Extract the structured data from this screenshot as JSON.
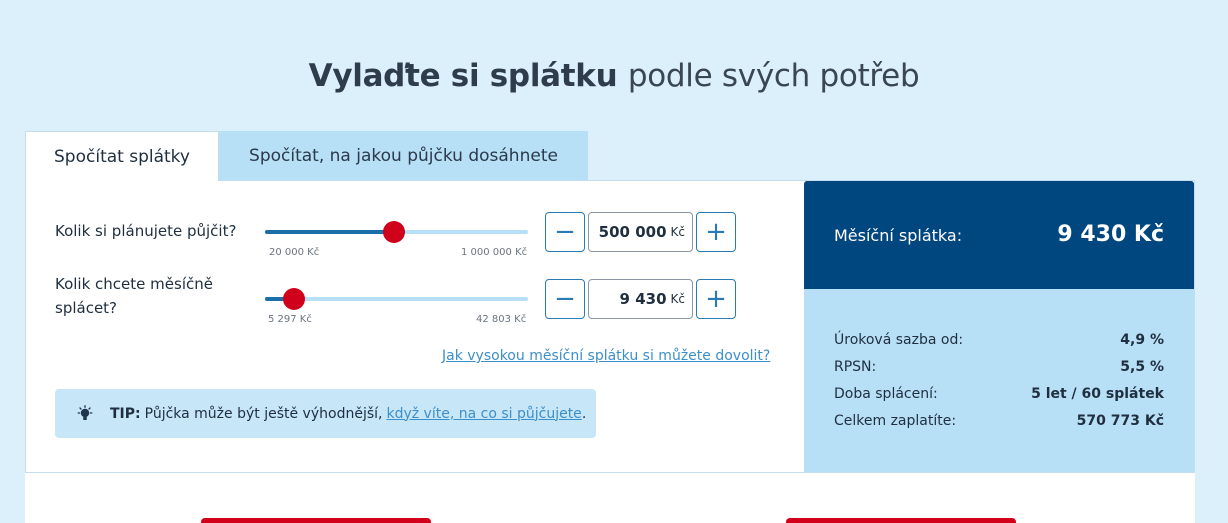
{
  "headline": {
    "bold": "Vylaďte si splátku",
    "light": "podle svých potřeb"
  },
  "tabs": [
    {
      "label": "Spočítat splátky",
      "active": true
    },
    {
      "label": "Spočítat, na jakou půjčku dosáhnete",
      "active": false
    }
  ],
  "loan": {
    "label": "Kolik si plánujete půjčit?",
    "min_label": "20 000 Kč",
    "max_label": "1 000 000 Kč",
    "min": 20000,
    "max": 1000000,
    "slider_position": 0.49,
    "value": "500 000",
    "unit": "Kč",
    "minus": "−",
    "plus": "+"
  },
  "monthly": {
    "label_line1": "Kolik chcete měsíčně",
    "label_line2": "splácet?",
    "min_label": "5 297 Kč",
    "max_label": "42 803 Kč",
    "min": 5297,
    "max": 42803,
    "slider_position": 0.11,
    "value": "9 430",
    "unit": "Kč",
    "minus": "−",
    "plus": "+"
  },
  "afford_link": "Jak vysokou měsíční splátku si můžete dovolit?",
  "tip": {
    "key": "TIP:",
    "text": "Půjčka může být ještě výhodnější,",
    "link": "když víte, na co si půjčujete",
    "end": "."
  },
  "result": {
    "label": "Měsíční splátka:",
    "value": "9 430 Kč",
    "details": [
      {
        "label": "Úroková sazba od:",
        "value": "4,9 %"
      },
      {
        "label": "RPSN:",
        "value": "5,5 %"
      },
      {
        "label": "Doba splácení:",
        "value": "5 let / 60 splátek"
      },
      {
        "label": "Celkem zaplatíte:",
        "value": "570 773 Kč"
      }
    ]
  },
  "colors": {
    "background": "#dcf0fc",
    "accent_dark": "#00467f",
    "accent_light": "#b7dff6",
    "slider_thumb": "#d0021b",
    "link": "#3d8fc9",
    "cta": "#d3001b"
  },
  "icons": {
    "tip": "lightbulb-icon"
  }
}
